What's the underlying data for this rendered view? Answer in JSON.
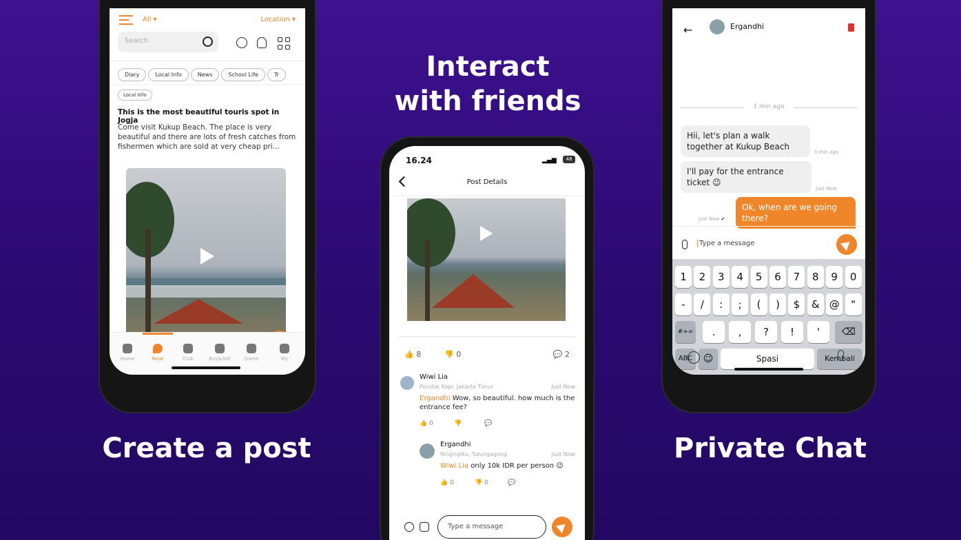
{
  "left": {
    "caption": "Create a post",
    "filter_all": "All",
    "filter_location": "Location",
    "search_placeholder": "Search",
    "chips": [
      "Diary",
      "Local Info",
      "News",
      "School Life",
      "Tr"
    ],
    "post_tag": "Local Info",
    "post_title": "This is the most beautiful touris spot in Jogja",
    "post_body": "Come visit Kukup Beach. The place is very beautiful and there are lots of fresh catches from fishermen which are sold at very cheap pri...",
    "fab": "+",
    "tabs": [
      "Home",
      "Near",
      "Club",
      "Buy&Sell",
      "Game",
      "My"
    ],
    "active_tab": "Near"
  },
  "middle": {
    "caption_line1": "Interact",
    "caption_line2": "with friends",
    "time": "16.24",
    "battery": "48",
    "title": "Post Details",
    "likes": "8",
    "dislikes": "0",
    "comments": "2",
    "comment1": {
      "name": "Wiwi Lia",
      "location": "Pondok Kopi, Jakarta Timur",
      "time": "Just Now",
      "mention": "Ergandhi",
      "text": " Wow, so beautiful. how much is the entrance fee?",
      "likes": "0"
    },
    "comment2": {
      "name": "Ergandhi",
      "location": "Ringinpitu, Tulungagung",
      "time": "Just Now",
      "mention": "Wiwi Lia",
      "text": " only 10k IDR per person 😉",
      "likes": "0",
      "dislikes": "0"
    },
    "input_placeholder": "Type a message"
  },
  "right": {
    "caption": "Private Chat",
    "contact": "Ergandhi",
    "divider": "1 min ago",
    "msg1": "Hii, let's plan a walk together at Kukup Beach",
    "msg1_time": "1 min ago",
    "msg2": "I'll pay for the entrance ticket 😉",
    "msg2_time": "Just Now",
    "msg3": "Ok, when are we going there?",
    "msg3_time": "Just Now",
    "input_placeholder": "Type a message",
    "keyboard": {
      "row1": [
        "1",
        "2",
        "3",
        "4",
        "5",
        "6",
        "7",
        "8",
        "9",
        "0"
      ],
      "row2": [
        "-",
        "/",
        ":",
        ";",
        "(",
        ")",
        "$",
        "&",
        "@",
        "\""
      ],
      "row3_left": "#+=",
      "row3": [
        ".",
        ",",
        "?",
        "!",
        "'"
      ],
      "abc": "ABC",
      "space": "Spasi",
      "return": "Kembali"
    }
  },
  "colors": {
    "accent": "#f0862a",
    "bg": "#2f0b78"
  }
}
